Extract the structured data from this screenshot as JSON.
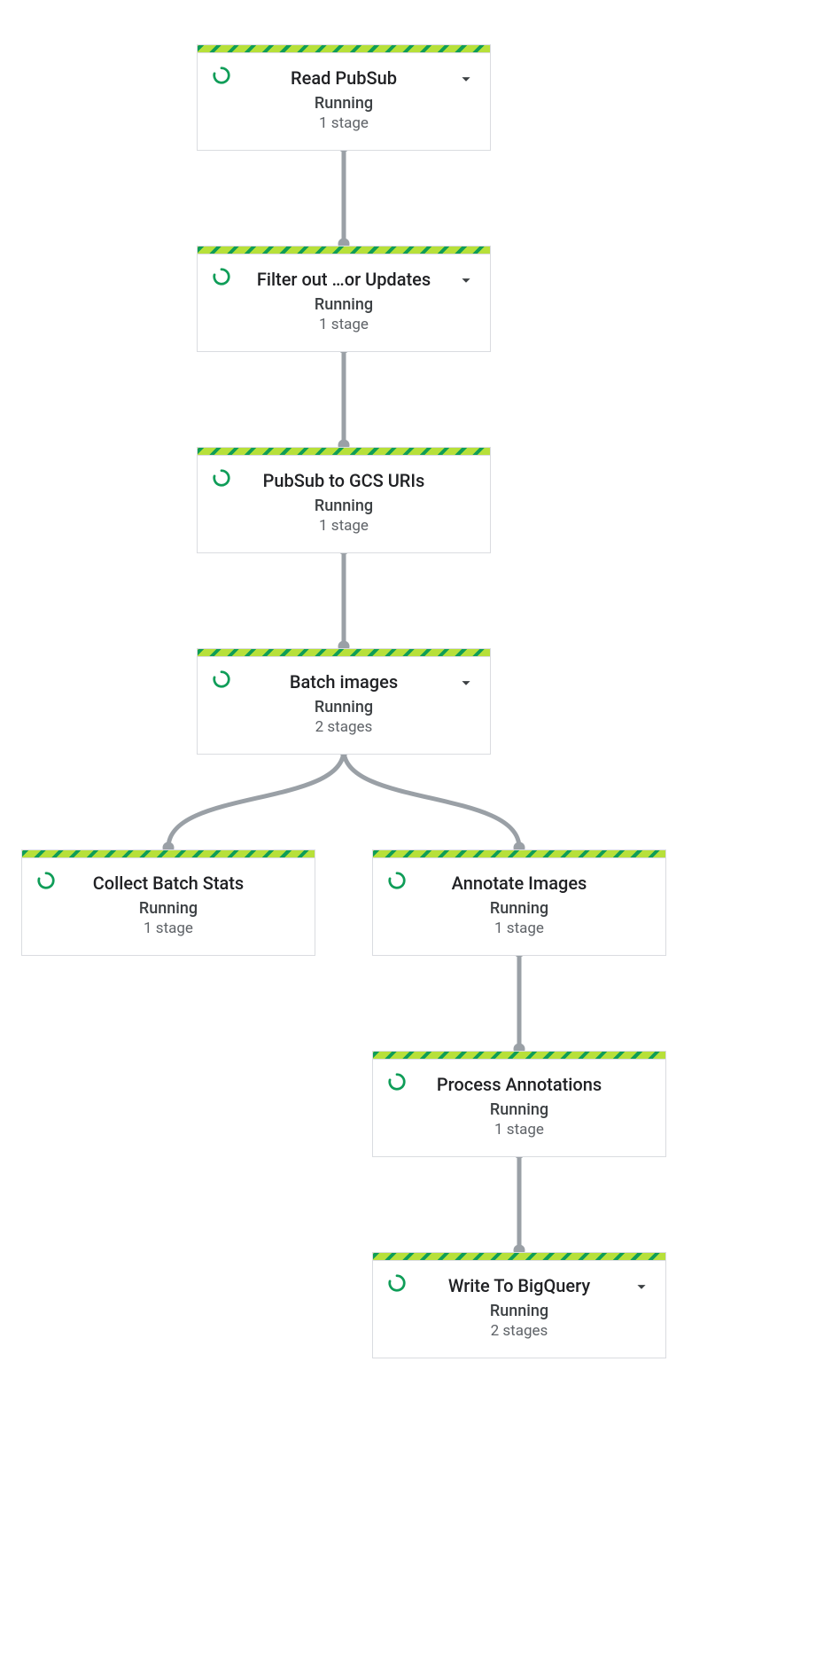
{
  "nodes": {
    "n0": {
      "title": "Read PubSub",
      "status": "Running",
      "stages": "1 stage",
      "expandable": true
    },
    "n1": {
      "title": "Filter out …or Updates",
      "status": "Running",
      "stages": "1 stage",
      "expandable": true
    },
    "n2": {
      "title": "PubSub to GCS URIs",
      "status": "Running",
      "stages": "1 stage",
      "expandable": false
    },
    "n3": {
      "title": "Batch images",
      "status": "Running",
      "stages": "2 stages",
      "expandable": true
    },
    "n4": {
      "title": "Collect Batch Stats",
      "status": "Running",
      "stages": "1 stage",
      "expandable": false
    },
    "n5": {
      "title": "Annotate Images",
      "status": "Running",
      "stages": "1 stage",
      "expandable": false
    },
    "n6": {
      "title": "Process Annotations",
      "status": "Running",
      "stages": "1 stage",
      "expandable": false
    },
    "n7": {
      "title": "Write To BigQuery",
      "status": "Running",
      "stages": "2 stages",
      "expandable": true
    }
  },
  "colors": {
    "running_green": "#0f9d58",
    "stripe_light": "#b7e03a",
    "connector_gray": "#9aa0a6",
    "border_gray": "#dadce0"
  }
}
